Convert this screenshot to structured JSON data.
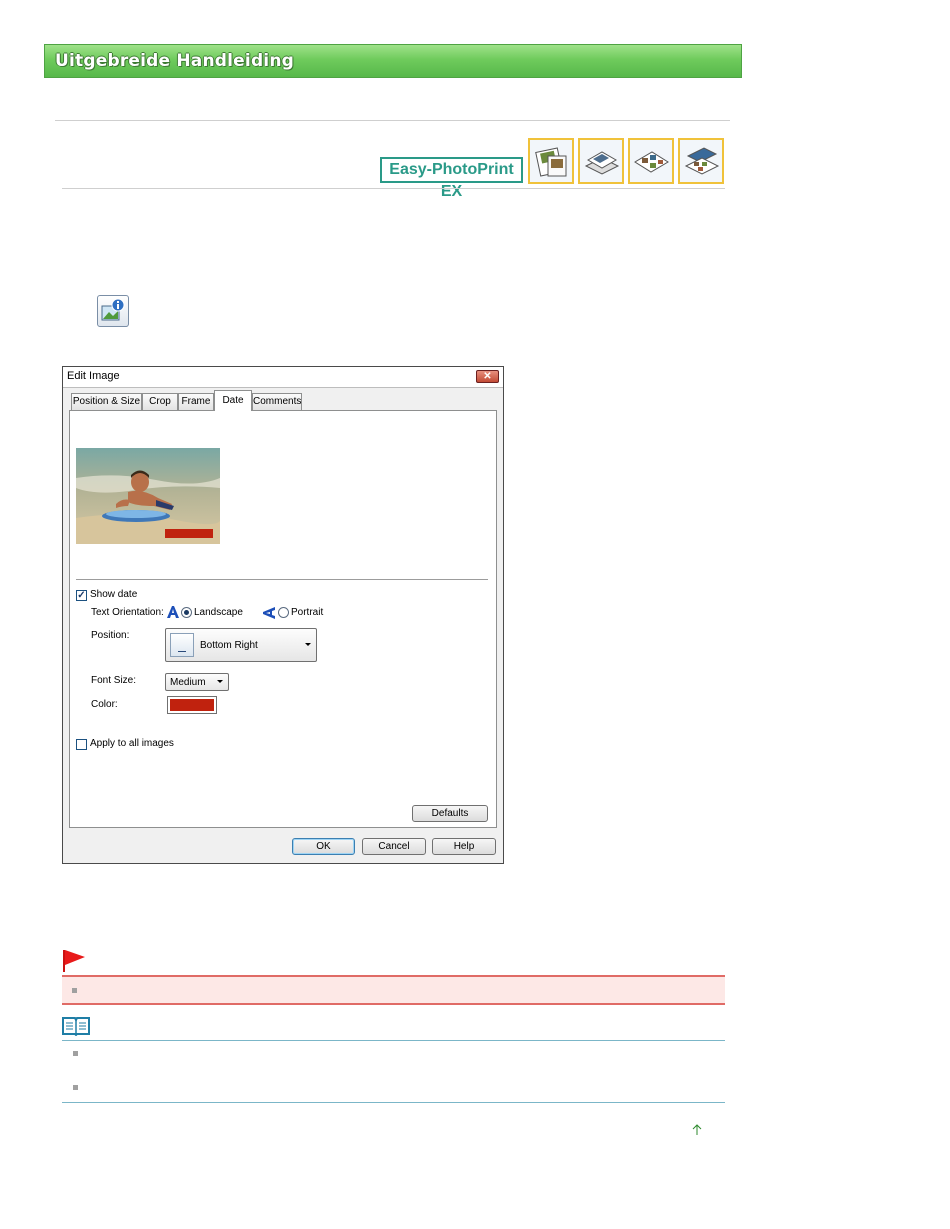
{
  "header": {
    "title": "Uitgebreide Handleiding"
  },
  "product": {
    "logo_text": "Easy-PhotoPrint EX"
  },
  "nav_icons": [
    "album-icon",
    "calendar-icon",
    "layout-print-icon",
    "sticker-icon"
  ],
  "dialog": {
    "title": "Edit Image",
    "close_label": "✕",
    "tabs": [
      "Position & Size",
      "Crop",
      "Frame",
      "Date",
      "Comments"
    ],
    "active_tab": "Date",
    "show_date": {
      "label": "Show date",
      "checked": true
    },
    "text_orientation": {
      "label": "Text Orientation:",
      "options": [
        {
          "label": "Landscape",
          "selected": true
        },
        {
          "label": "Portrait",
          "selected": false
        }
      ]
    },
    "position": {
      "label": "Position:",
      "value": "Bottom Right"
    },
    "font_size": {
      "label": "Font Size:",
      "value": "Medium"
    },
    "color": {
      "label": "Color:",
      "value": "#c0220e"
    },
    "apply_all": {
      "label": "Apply to all images",
      "checked": false
    },
    "buttons": {
      "defaults": "Defaults",
      "ok": "OK",
      "cancel": "Cancel",
      "help": "Help"
    }
  },
  "colors": {
    "banner": "#6fcb5c",
    "logo_teal": "#2a9a88",
    "important_bg": "#fde8e6",
    "important_line": "#e06b66",
    "note_line": "#7bb6c8"
  }
}
